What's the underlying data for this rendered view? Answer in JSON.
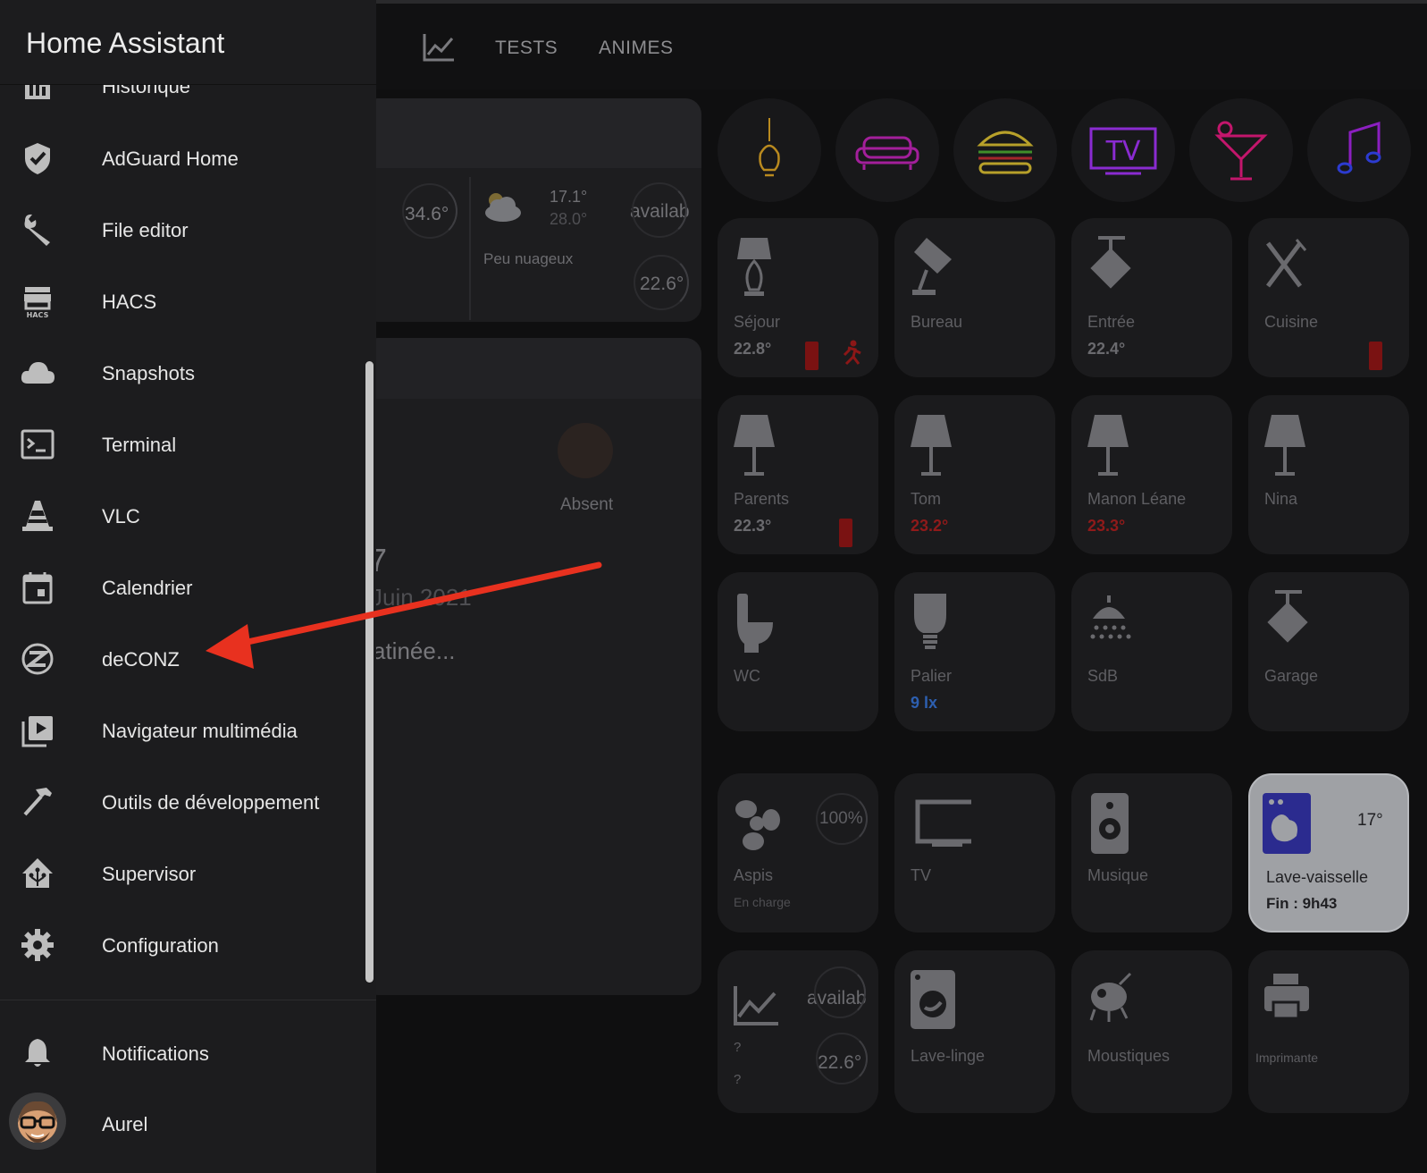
{
  "header": {
    "title": "Home Assistant"
  },
  "top_tabs": [
    "TESTS",
    "ANIMES"
  ],
  "sidebar": {
    "items": [
      {
        "label": "Historique",
        "icon": "chart-bar-icon"
      },
      {
        "label": "AdGuard Home",
        "icon": "shield-check-icon"
      },
      {
        "label": "File editor",
        "icon": "wrench-icon"
      },
      {
        "label": "HACS",
        "icon": "hacs-store-icon"
      },
      {
        "label": "Snapshots",
        "icon": "cloud-icon"
      },
      {
        "label": "Terminal",
        "icon": "console-icon"
      },
      {
        "label": "VLC",
        "icon": "traffic-cone-icon"
      },
      {
        "label": "Calendrier",
        "icon": "calendar-icon"
      },
      {
        "label": "deCONZ",
        "icon": "zigbee-icon"
      },
      {
        "label": "Navigateur multimédia",
        "icon": "play-box-multiple-icon"
      },
      {
        "label": "Outils de développement",
        "icon": "hammer-icon"
      },
      {
        "label": "Supervisor",
        "icon": "home-assistant-icon"
      },
      {
        "label": "Configuration",
        "icon": "gear-icon"
      }
    ],
    "notifications": "Notifications",
    "user": "Aurel"
  },
  "weather": {
    "temp_left": "34.6°",
    "high": "17.1°",
    "low": "28.0°",
    "status": "availab",
    "condition": "Peu nuageux",
    "temp_right": "22.6°"
  },
  "presence": {
    "person_state": "Absent",
    "date_number": "7",
    "date_text": "Juin 2021",
    "period": "atinée..."
  },
  "scene_icons": [
    "bulb-icon",
    "sofa-icon",
    "burger-icon",
    "tv-neon-icon",
    "cocktail-icon",
    "music-icon"
  ],
  "rooms": [
    {
      "name": "Séjour",
      "temp": "22.8°",
      "icon": "lamp-icon"
    },
    {
      "name": "Bureau",
      "temp": "",
      "icon": "desk-lamp-icon"
    },
    {
      "name": "Entrée",
      "temp": "22.4°",
      "icon": "ceiling-light-icon"
    },
    {
      "name": "Cuisine",
      "temp": "",
      "icon": "silverware-icon"
    },
    {
      "name": "Parents",
      "temp": "22.3°",
      "icon": "floor-lamp-icon"
    },
    {
      "name": "Tom",
      "temp": "23.2°",
      "icon": "floor-lamp-icon"
    },
    {
      "name": "Manon Léane",
      "temp": "23.3°",
      "icon": "floor-lamp-icon"
    },
    {
      "name": "Nina",
      "temp": "",
      "icon": "floor-lamp-icon"
    },
    {
      "name": "WC",
      "temp": "",
      "icon": "toilet-icon"
    },
    {
      "name": "Palier",
      "temp": "9 lx",
      "icon": "lightbulb-icon"
    },
    {
      "name": "SdB",
      "temp": "",
      "icon": "shower-icon"
    },
    {
      "name": "Garage",
      "temp": "",
      "icon": "ceiling-light-icon"
    }
  ],
  "devices": [
    {
      "name": "Aspis",
      "sub": "En charge",
      "value": "100%",
      "icon": "fan-icon"
    },
    {
      "name": "TV",
      "sub": "",
      "value": "",
      "icon": "monitor-icon"
    },
    {
      "name": "Musique",
      "sub": "",
      "value": "",
      "icon": "speaker-icon"
    },
    {
      "name": "Lave-vaisselle",
      "sub": "Fin : 9h43",
      "value": "17°",
      "icon": "dishwasher-icon"
    },
    {
      "name": "?",
      "sub": "?",
      "value": "availab",
      "value2": "22.6°",
      "icon": "chart-line-icon"
    },
    {
      "name": "Lave-linge",
      "sub": "",
      "value": "",
      "icon": "washing-machine-icon"
    },
    {
      "name": "Moustiques",
      "sub": "",
      "value": "",
      "icon": "mosquito-icon"
    },
    {
      "name": "Imprimante",
      "sub": "",
      "value": "",
      "icon": "printer-icon"
    }
  ],
  "colors": {
    "accent_arrow": "#e8311f",
    "sidebar_bg": "#1c1c1e",
    "lux": "#2d5fb0"
  }
}
